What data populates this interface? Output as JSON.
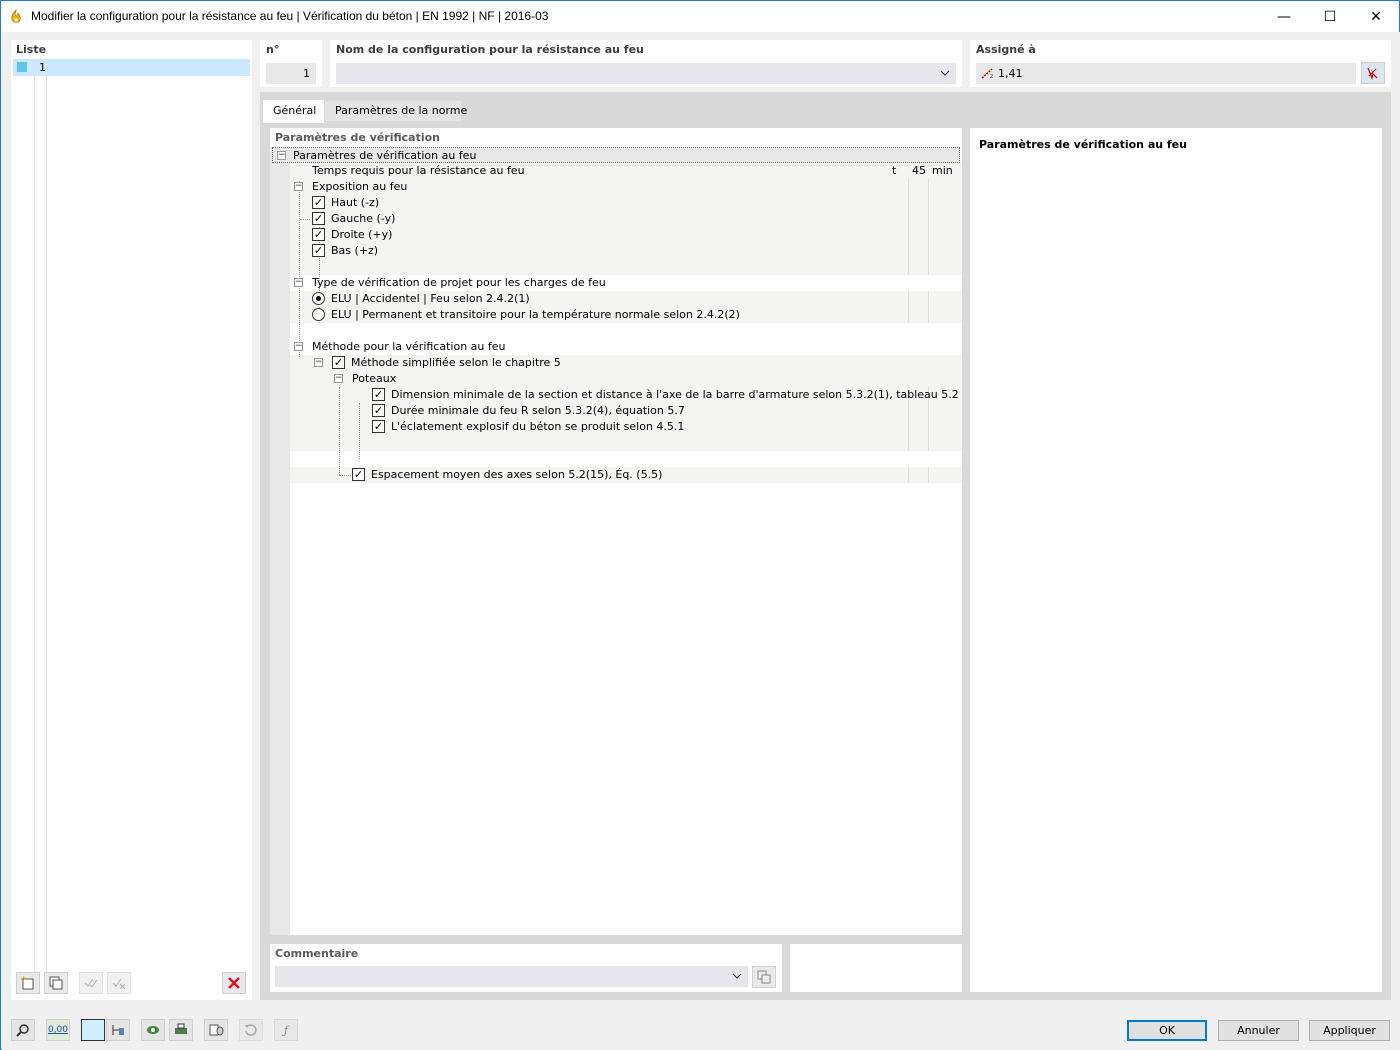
{
  "window": {
    "title": "Modifier la configuration pour la résistance au feu | Vérification du béton | EN 1992 | NF | 2016-03",
    "minimize_glyph": "—",
    "maximize_glyph": "☐",
    "close_glyph": "✕"
  },
  "list": {
    "header": "Liste",
    "items": [
      {
        "number": "1",
        "color": "#5cc6f5"
      }
    ]
  },
  "number_field": {
    "label": "n°",
    "value": "1"
  },
  "name_field": {
    "label": "Nom de la configuration pour la résistance au feu",
    "value": ""
  },
  "assigned_field": {
    "label": "Assigné à",
    "value": "1,41"
  },
  "tabs": [
    {
      "label": "Général",
      "active": true
    },
    {
      "label": "Paramètres de la norme",
      "active": false
    }
  ],
  "section_title": "Paramètres de vérification",
  "tree": {
    "root": "Paramètres de vérification au feu",
    "time_required": {
      "label": "Temps requis pour la résistance au feu",
      "symbol": "t",
      "value": "45",
      "unit": "min"
    },
    "exposure": {
      "label": "Exposition au feu",
      "items": [
        {
          "label": "Haut (-z)",
          "checked": true
        },
        {
          "label": "Gauche (-y)",
          "checked": true
        },
        {
          "label": "Droite (+y)",
          "checked": true
        },
        {
          "label": "Bas (+z)",
          "checked": true
        }
      ]
    },
    "verification_type": {
      "label": "Type de vérification de projet pour les charges de feu",
      "options": [
        {
          "label": "ELU | Accidentel | Feu selon 2.4.2(1)",
          "selected": true
        },
        {
          "label": "ELU | Permanent et transitoire pour la température normale selon 2.4.2(2)",
          "selected": false
        }
      ]
    },
    "method": {
      "label": "Méthode pour la vérification au feu",
      "simplified": {
        "label": "Méthode simplifiée selon le chapitre 5",
        "checked": true
      },
      "columns_label": "Poteaux",
      "column_items": [
        {
          "label": "Dimension minimale de la section et distance à l'axe de la barre d'armature selon 5.3.2(1), tableau 5.2",
          "checked": true
        },
        {
          "label": "Durée minimale du feu R selon 5.3.2(4), équation 5.7",
          "checked": true
        },
        {
          "label": "L'éclatement explosif du béton se produit selon 4.5.1",
          "checked": true
        }
      ],
      "spacing": {
        "label": "Espacement moyen des axes selon 5.2(15), Éq. (5.5)",
        "checked": true
      }
    }
  },
  "info_panel": {
    "title": "Paramètres de vérification au feu"
  },
  "comment": {
    "label": "Commentaire",
    "value": ""
  },
  "buttons": {
    "ok": "OK",
    "cancel": "Annuler",
    "apply": "Appliquer"
  },
  "bottom_tools": {
    "value_display": "0,00"
  },
  "colors": {
    "accent": "#1883d7",
    "selection": "#cce8ff",
    "list_swatch": "#5cc6f5",
    "close_red": "#e81123"
  }
}
